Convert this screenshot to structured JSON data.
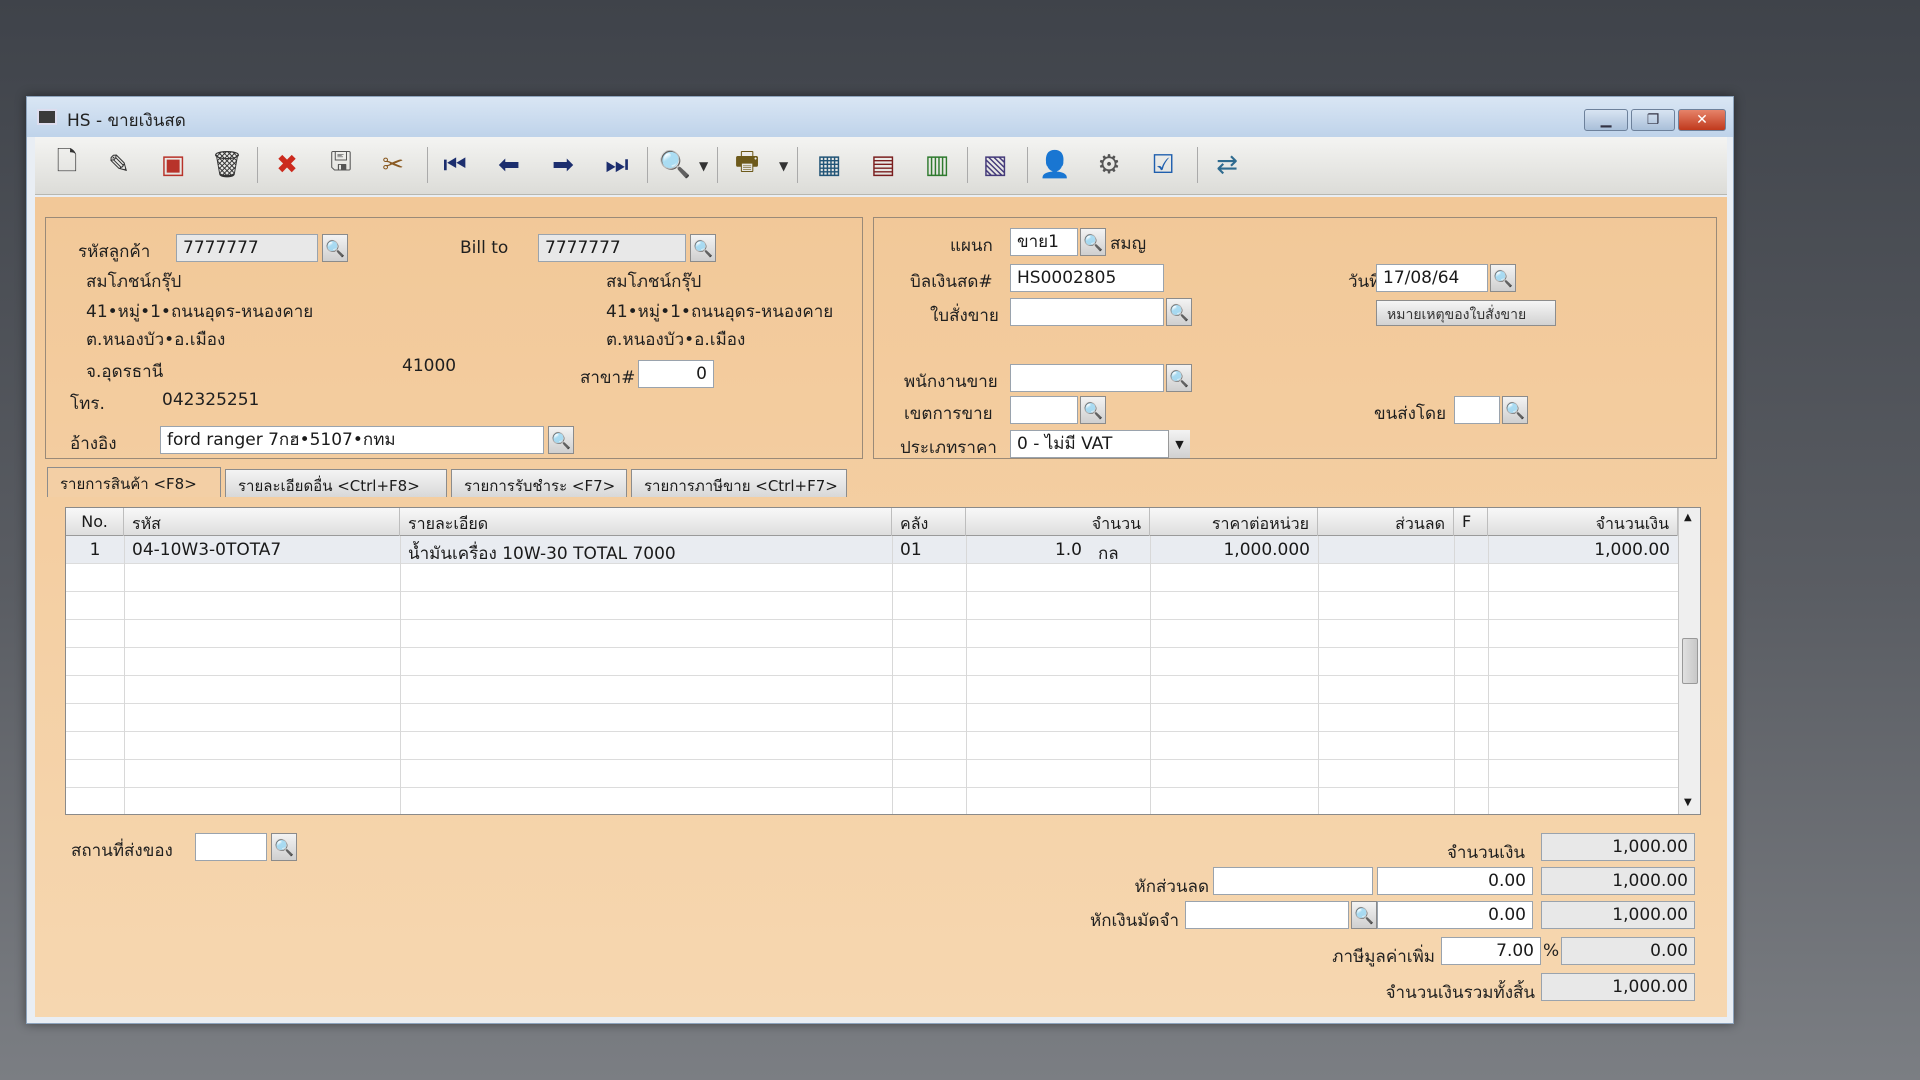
{
  "window": {
    "title": "HS - ขายเงินสด",
    "minimize": "▁",
    "maximize": "❐",
    "close": "✕"
  },
  "toolbar": {
    "icons": [
      "new-icon",
      "edit-icon",
      "void-icon",
      "delete-icon",
      "cancel-icon",
      "save-icon",
      "print-setup-icon",
      "first-record-icon",
      "previous-record-icon",
      "next-record-icon",
      "last-record-icon",
      "search-document-icon",
      "printer-icon",
      "grid-view-icon",
      "table-view-icon",
      "spreadsheet-icon",
      "report-icon",
      "approve-user-icon",
      "settings-icon",
      "ok-icon",
      "transfer-icon"
    ],
    "glyphs": {
      "new": "🗋",
      "edit": "✎",
      "void": "▣",
      "delete": "🗑",
      "cancel": "✖",
      "save": "🖫",
      "tools": "✂",
      "first": "⏮",
      "prev": "⬅",
      "next": "➡",
      "last": "⏭",
      "find": "🔍",
      "print": "🖶",
      "grid": "▦",
      "table": "▤",
      "sheet": "▥",
      "report": "▧",
      "user_ok": "👤",
      "gear": "⚙",
      "ok": "☑",
      "transfer": "⇄"
    }
  },
  "customer": {
    "code_label": "รหัสลูกค้า",
    "code_value": "7777777",
    "name": "สมโภชน์กรุ๊ป",
    "address1": "41•หมู่•1•ถนนอุดร-หนองคาย",
    "address2": "ต.หนองบัว•อ.เมือง",
    "province": "จ.อุดรธานี",
    "postcode": "41000",
    "phone_label": "โทร.",
    "phone_value": "042325251",
    "ref_label": "อ้างอิง",
    "ref_value": "ford ranger 7กฮ•5107•กทม"
  },
  "billto": {
    "label": "Bill to",
    "value": "7777777",
    "name": "สมโภชน์กรุ๊ป",
    "address1": "41•หมู่•1•ถนนอุดร-หนองคาย",
    "address2": "ต.หนองบัว•อ.เมือง",
    "branch_label": "สาขา#",
    "branch_value": "0"
  },
  "doc": {
    "dept_label": "แผนก",
    "dept_value": "ขาย1",
    "dept_name": "สมญ",
    "bill_label": "บิลเงินสด#",
    "bill_value": "HS0002805",
    "date_label": "วันที่",
    "date_value": "17/08/64",
    "order_label": "ใบสั่งขาย",
    "order_value": "",
    "note_button": "หมายเหตุของใบสั่งขาย",
    "salesman_label": "พนักงานขาย",
    "salesman_value": "",
    "zone_label": "เขตการขาย",
    "zone_value": "",
    "ship_label": "ขนส่งโดย",
    "ship_value": "",
    "price_type_label": "ประเภทราคา",
    "price_type_value": "0 - ไม่มี VAT"
  },
  "tabs": [
    {
      "label": "รายการสินค้า <F8>"
    },
    {
      "label": "รายละเอียดอื่น <Ctrl+F8>"
    },
    {
      "label": "รายการรับชำระ <F7>"
    },
    {
      "label": "รายการภาษีขาย <Ctrl+F7>"
    }
  ],
  "grid": {
    "headers": {
      "no": "No.",
      "code": "รหัส",
      "desc": "รายละเอียด",
      "wh": "คลัง",
      "qty": "จำนวน",
      "unit_price": "ราคาต่อหน่วย",
      "discount": "ส่วนลด",
      "f": "F",
      "amount": "จำนวนเงิน"
    },
    "rows": [
      {
        "no": "1",
        "code": "04-10W3-0TOTA7",
        "desc": "น้ำมันเครื่อง 10W-30 TOTAL 7000",
        "wh": "01",
        "qty": "1.0",
        "unit": "กล",
        "unit_price": "1,000.000",
        "discount": "",
        "f": "",
        "amount": "1,000.00"
      }
    ]
  },
  "footer": {
    "delivery_label": "สถานที่ส่งของ",
    "delivery_value": "",
    "amount_label": "จำนวนเงิน",
    "amount_value": "1,000.00",
    "discount_label": "หักส่วนลด",
    "discount_input": "",
    "discount_amount": "0.00",
    "discount_total": "1,000.00",
    "deposit_label": "หักเงินมัดจำ",
    "deposit_input": "",
    "deposit_amount": "0.00",
    "deposit_total": "1,000.00",
    "vat_label": "ภาษีมูลค่าเพิ่ม",
    "vat_rate": "7.00",
    "vat_pct": "%",
    "vat_amount": "0.00",
    "grand_label": "จำนวนเงินรวมทั้งสิ้น",
    "grand_value": "1,000.00"
  }
}
